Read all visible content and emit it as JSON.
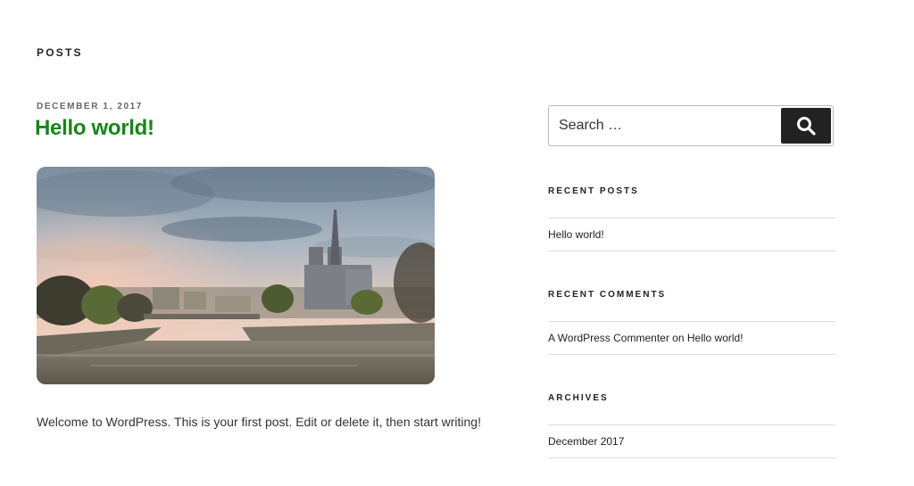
{
  "page": {
    "section_title": "POSTS"
  },
  "post": {
    "date": "DECEMBER 1, 2017",
    "title": "Hello world!",
    "excerpt": "Welcome to WordPress. This is your first post. Edit or delete it, then start writing!"
  },
  "search": {
    "placeholder": "Search …"
  },
  "recent_posts": {
    "title": "RECENT POSTS",
    "items": [
      {
        "label": "Hello world!"
      }
    ]
  },
  "recent_comments": {
    "title": "RECENT COMMENTS",
    "items": [
      {
        "author": "A WordPress Commenter",
        "connector": "on",
        "post": "Hello world!"
      }
    ]
  },
  "archives": {
    "title": "ARCHIVES",
    "items": [
      {
        "label": "December 2017"
      }
    ]
  },
  "colors": {
    "post_title": "#1a8418",
    "search_button": "#222222"
  },
  "icons": {
    "search_button": "search-icon"
  }
}
